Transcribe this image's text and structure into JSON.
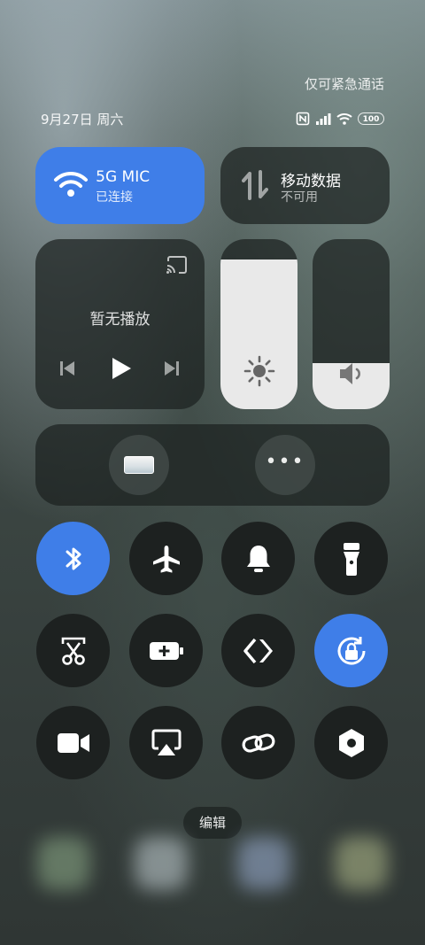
{
  "status": {
    "emergency_text": "仅可紧急通话",
    "date": "9月27日 周六",
    "battery": "100"
  },
  "wifi": {
    "name": "-5G    MIC",
    "status": "已连接",
    "on": true
  },
  "mobile_data": {
    "title": "移动数据",
    "status": "不可用"
  },
  "media": {
    "status": "暂无播放"
  },
  "brightness_level": 0.88,
  "volume_level": 0.27,
  "toggles": [
    {
      "name": "bluetooth",
      "on": true
    },
    {
      "name": "airplane-mode",
      "on": false
    },
    {
      "name": "ringer",
      "on": false
    },
    {
      "name": "flashlight",
      "on": false
    },
    {
      "name": "screenshot",
      "on": false
    },
    {
      "name": "battery-saver",
      "on": false
    },
    {
      "name": "nearby-share",
      "on": false
    },
    {
      "name": "rotation-lock",
      "on": true
    },
    {
      "name": "screen-record",
      "on": false
    },
    {
      "name": "screen-cast",
      "on": false
    },
    {
      "name": "link",
      "on": false
    },
    {
      "name": "settings",
      "on": false
    }
  ],
  "edit_label": "编辑",
  "colors": {
    "accent": "#3f7ee8",
    "tile_dark": "#1d2120"
  }
}
